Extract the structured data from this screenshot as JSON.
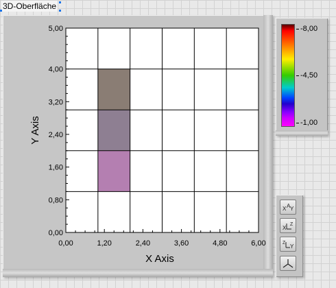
{
  "control_label": "3D-Oberfläche",
  "graph": {
    "x_axis_label": "X Axis",
    "y_axis_label": "Y Axis",
    "x_ticks": [
      "0,00",
      "1,20",
      "2,40",
      "3,60",
      "4,80",
      "6,00"
    ],
    "y_ticks": [
      "0,00",
      "0,80",
      "1,60",
      "2,40",
      "3,20",
      "4,00",
      "5,00"
    ]
  },
  "color_scale": {
    "labels": [
      "-8,00",
      "-4,50",
      "-1,00"
    ],
    "values": [
      -8.0,
      -4.5,
      -1.0
    ]
  },
  "tools": [
    {
      "name": "xy-plane-view-icon",
      "label": "XY"
    },
    {
      "name": "xz-plane-view-icon",
      "label": "XZ"
    },
    {
      "name": "yz-plane-view-icon",
      "label": "ZY"
    },
    {
      "name": "3d-view-icon",
      "label": "3D"
    }
  ],
  "chart_data": {
    "type": "heatmap",
    "xlabel": "X Axis",
    "ylabel": "Y Axis",
    "xlim": [
      0,
      6
    ],
    "ylim": [
      0,
      5
    ],
    "x_ticks": [
      0,
      1.2,
      2.4,
      3.6,
      4.8,
      6.0
    ],
    "y_ticks": [
      0,
      0.8,
      1.6,
      2.4,
      3.2,
      4.0,
      5.0
    ],
    "grid": true,
    "colorbar": {
      "min": -8.0,
      "max": -1.0,
      "ticks": [
        -8.0,
        -4.5,
        -1.0
      ]
    },
    "cells": [
      {
        "x": [
          1,
          2
        ],
        "y": [
          1,
          2
        ],
        "color": "#b47fb1"
      },
      {
        "x": [
          1,
          2
        ],
        "y": [
          2,
          3
        ],
        "color": "#8e7f92"
      },
      {
        "x": [
          1,
          2
        ],
        "y": [
          3,
          4
        ],
        "color": "#8a7d74"
      }
    ]
  }
}
